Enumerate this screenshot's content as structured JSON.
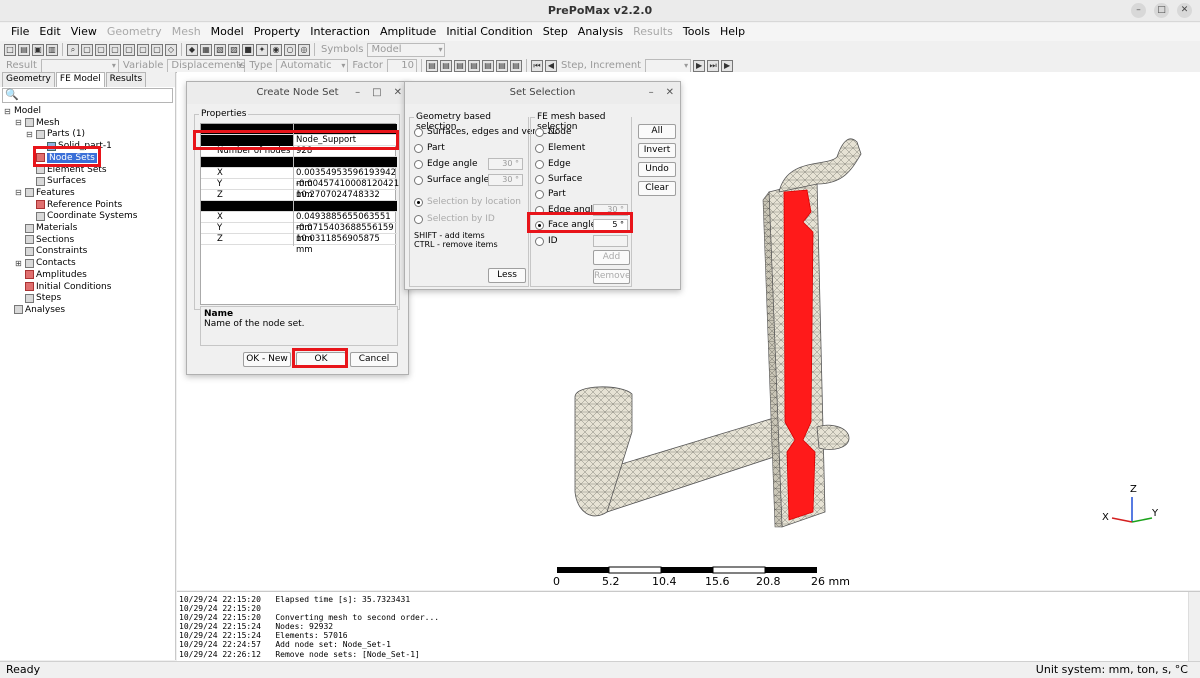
{
  "window": {
    "title": "PrePoMax v2.2.0",
    "controls": [
      "–",
      "□",
      "✕"
    ]
  },
  "menu": {
    "items": [
      {
        "label": "File",
        "enabled": true
      },
      {
        "label": "Edit",
        "enabled": true
      },
      {
        "label": "View",
        "enabled": true
      },
      {
        "label": "Geometry",
        "enabled": false
      },
      {
        "label": "Mesh",
        "enabled": false
      },
      {
        "label": "Model",
        "enabled": true
      },
      {
        "label": "Property",
        "enabled": true
      },
      {
        "label": "Interaction",
        "enabled": true
      },
      {
        "label": "Amplitude",
        "enabled": true
      },
      {
        "label": "Initial Condition",
        "enabled": true
      },
      {
        "label": "Step",
        "enabled": true
      },
      {
        "label": "Analysis",
        "enabled": true
      },
      {
        "label": "Results",
        "enabled": false
      },
      {
        "label": "Tools",
        "enabled": true
      },
      {
        "label": "Help",
        "enabled": true
      }
    ]
  },
  "toolbar": {
    "symbols_label": "Symbols",
    "symbols_value": "Model",
    "result_label": "Result",
    "variable_label": "Variable",
    "variable_value": "Displacements",
    "type_label": "Type",
    "type_value": "Automatic",
    "factor_label": "Factor",
    "factor_value": "10",
    "step_label": "Step, Increment"
  },
  "left_panel": {
    "tabs": [
      {
        "label": "Geometry",
        "active": false
      },
      {
        "label": "FE Model",
        "active": true
      },
      {
        "label": "Results",
        "active": false
      }
    ],
    "search_icon": "🔍",
    "tree": [
      {
        "label": "Model",
        "level": 0,
        "expander": "⊟",
        "icon": "none"
      },
      {
        "label": "Mesh",
        "level": 1,
        "expander": "⊟",
        "icon": "mesh-icon"
      },
      {
        "label": "Parts (1)",
        "level": 2,
        "expander": "⊟",
        "icon": "parts-icon"
      },
      {
        "label": "Solid_part-1",
        "level": 3,
        "expander": "",
        "icon": "solid-part-icon"
      },
      {
        "label": "Node Sets",
        "level": 2,
        "expander": "",
        "icon": "node-sets-icon",
        "selected": true
      },
      {
        "label": "Element Sets",
        "level": 2,
        "expander": "",
        "icon": "element-sets-icon"
      },
      {
        "label": "Surfaces",
        "level": 2,
        "expander": "",
        "icon": "surfaces-icon"
      },
      {
        "label": "Features",
        "level": 1,
        "expander": "⊟",
        "icon": "features-icon"
      },
      {
        "label": "Reference Points",
        "level": 2,
        "expander": "",
        "icon": "reference-points-icon"
      },
      {
        "label": "Coordinate Systems",
        "level": 2,
        "expander": "",
        "icon": "coordinate-systems-icon"
      },
      {
        "label": "Materials",
        "level": 1,
        "expander": "",
        "icon": "materials-icon"
      },
      {
        "label": "Sections",
        "level": 1,
        "expander": "",
        "icon": "sections-icon"
      },
      {
        "label": "Constraints",
        "level": 1,
        "expander": "",
        "icon": "constraints-icon"
      },
      {
        "label": "Contacts",
        "level": 1,
        "expander": "⊞",
        "icon": "contacts-icon"
      },
      {
        "label": "Amplitudes",
        "level": 1,
        "expander": "",
        "icon": "amplitudes-icon"
      },
      {
        "label": "Initial Conditions",
        "level": 1,
        "expander": "",
        "icon": "initial-conditions-icon"
      },
      {
        "label": "Steps",
        "level": 1,
        "expander": "",
        "icon": "steps-icon"
      },
      {
        "label": "Analyses",
        "level": 0,
        "expander": "",
        "icon": "analyses-icon"
      }
    ]
  },
  "create_node_set": {
    "title": "Create Node Set",
    "controls": [
      "–",
      "□",
      "✕"
    ],
    "group_title": "Properties",
    "name_value": "Node_Support",
    "nodes_key": "Number of nodes",
    "nodes_value": "928",
    "center1": [
      {
        "key": "X",
        "value": "0.00354953596193942 mm"
      },
      {
        "key": "Y",
        "value": "-0.00457410008120421 mm"
      },
      {
        "key": "Z",
        "value": "10.2707024748332 mm"
      }
    ],
    "center2": [
      {
        "key": "X",
        "value": "0.0493885655063551 mm"
      },
      {
        "key": "Y",
        "value": "-0.0715403688556159 mm"
      },
      {
        "key": "Z",
        "value": "10.0311856905875 mm"
      }
    ],
    "help_title": "Name",
    "help_text": "Name of the node set.",
    "ok_new_label": "OK - New",
    "ok_label": "OK",
    "cancel_label": "Cancel"
  },
  "set_selection": {
    "title": "Set Selection",
    "controls": [
      "–",
      "✕"
    ],
    "geometry_group": "Geometry based selection",
    "geometry_options": [
      {
        "label": "Surfaces, edges and vertices",
        "checked": false,
        "enabled": true
      },
      {
        "label": "Part",
        "checked": false,
        "enabled": true
      },
      {
        "label": "Edge angle",
        "checked": false,
        "enabled": true,
        "value": "30 °"
      },
      {
        "label": "Surface angle",
        "checked": false,
        "enabled": true,
        "value": "30 °"
      },
      {
        "label": "Selection by location",
        "checked": true,
        "enabled": false
      },
      {
        "label": "Selection by ID",
        "checked": false,
        "enabled": false
      }
    ],
    "shift_note": "SHIFT - add items",
    "ctrl_note": "CTRL - remove items",
    "less_label": "Less",
    "mesh_group": "FE mesh based selection",
    "mesh_options": [
      {
        "label": "Node",
        "checked": false
      },
      {
        "label": "Element",
        "checked": false
      },
      {
        "label": "Edge",
        "checked": false
      },
      {
        "label": "Surface",
        "checked": false
      },
      {
        "label": "Part",
        "checked": false
      },
      {
        "label": "Edge angle",
        "checked": false,
        "value": "30 °"
      },
      {
        "label": "Face angle",
        "checked": true,
        "value": "5 °"
      },
      {
        "label": "ID",
        "checked": false,
        "value": ""
      }
    ],
    "add_label": "Add",
    "remove_label": "Remove",
    "all_label": "All",
    "invert_label": "Invert",
    "undo_label": "Undo",
    "clear_label": "Clear"
  },
  "viewport": {
    "scale_labels": [
      "0",
      "5.2",
      "10.4",
      "15.6",
      "20.8",
      "26 mm"
    ],
    "axis_z": "Z",
    "axis_x": "X",
    "axis_y": "Y",
    "mesh_color": "#e8e4d6",
    "selection_color": "#ff1a1a"
  },
  "log": {
    "lines": [
      "10/29/24 22:15:20   Elapsed time [s]: 35.7323431",
      "10/29/24 22:15:20",
      "10/29/24 22:15:20   Converting mesh to second order...",
      "10/29/24 22:15:24   Nodes: 92932",
      "10/29/24 22:15:24   Elements: 57016",
      "10/29/24 22:24:57   Add node set: Node_Set-1",
      "10/29/24 22:26:12   Remove node sets: [Node_Set-1]"
    ]
  },
  "status": {
    "left": "Ready",
    "right": "Unit system: mm, ton, s, °C"
  }
}
